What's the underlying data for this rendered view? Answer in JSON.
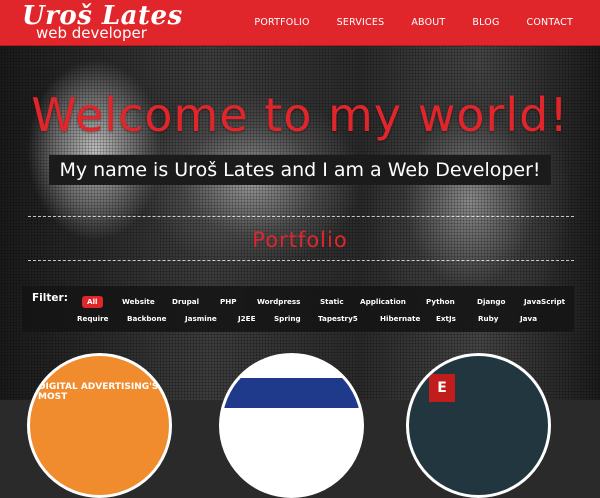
{
  "logo": {
    "name": "Uroš Lates",
    "subtitle": "web developer"
  },
  "nav": {
    "items": [
      "PORTFOLIO",
      "SERVICES",
      "ABOUT",
      "BLOG",
      "CONTACT"
    ]
  },
  "hero": {
    "heading": "Welcome to my world!",
    "tagline": "My name is Uroš Lates and I am a Web Developer!"
  },
  "portfolio": {
    "title": "Portfolio"
  },
  "filter": {
    "label": "Filter:",
    "active": "All",
    "row1": [
      "All",
      "Website",
      "Drupal",
      "PHP",
      "Wordpress",
      "Static",
      "Application",
      "Python",
      "Django",
      "JavaScript"
    ],
    "row2": [
      "Require",
      "Backbone",
      "Jasmine",
      "J2EE",
      "Spring",
      "Tapestry5",
      "Hibernate",
      "ExtJs",
      "Ruby",
      "Java"
    ]
  },
  "thumbnails": {
    "first_text": "DIGITAL ADVERTISING'S MOST",
    "badge": "E"
  },
  "colors": {
    "brand_red": "#e0262b",
    "panel_dark": "#141414"
  }
}
